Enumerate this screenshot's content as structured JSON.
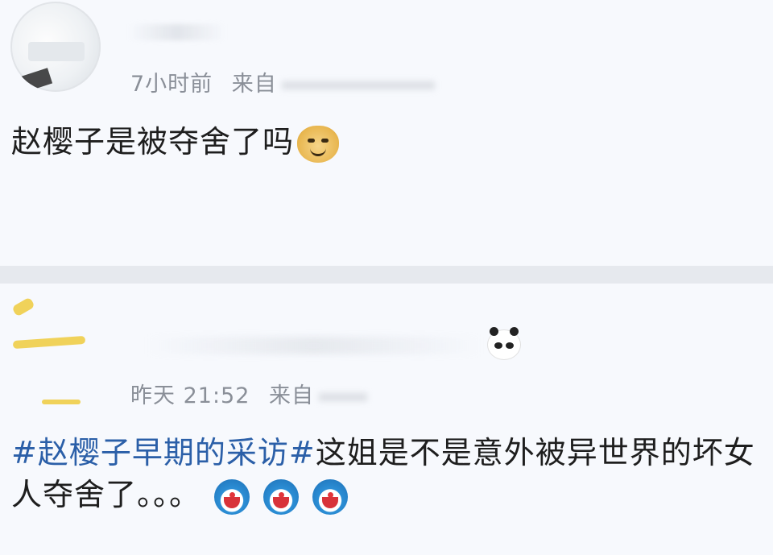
{
  "posts": [
    {
      "time": "7小时前",
      "source_prefix": "来自",
      "source_tail": "iPhone",
      "text": "赵樱子是被夺舍了吗",
      "emojis": [
        "doge-icon"
      ]
    },
    {
      "time": "昨天 21:52",
      "source_prefix": "来自",
      "hashtag": "#赵樱子早期的采访#",
      "text": "这姐是不是意外被异世界的坏女人夺舍了。。。",
      "emojis": [
        "doraemon-icon",
        "doraemon-icon",
        "doraemon-icon"
      ],
      "badge_icon": "panda-icon"
    }
  ],
  "colors": {
    "hashtag": "#2b5fa8",
    "meta": "#8a8f98",
    "divider": "#e6e9ee",
    "background": "#f7f9fd"
  }
}
